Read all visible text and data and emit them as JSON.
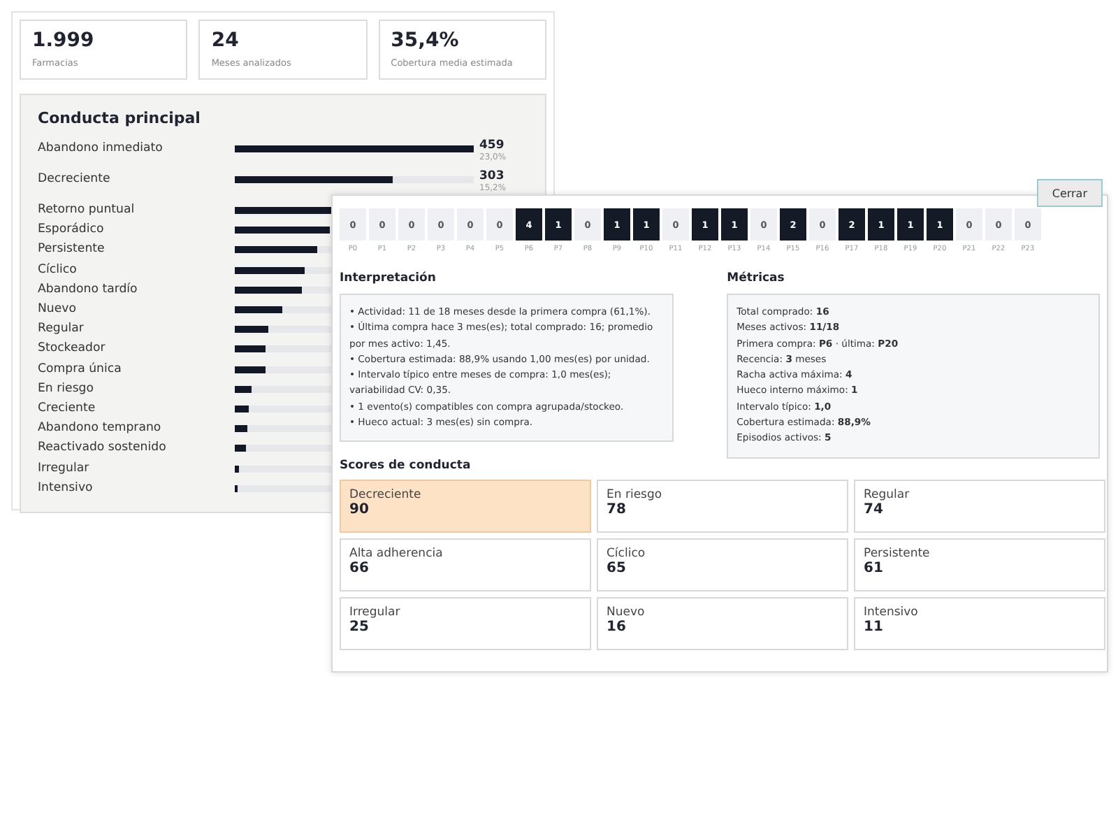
{
  "stats": [
    {
      "value": "1.999",
      "label": "Farmacias"
    },
    {
      "value": "24",
      "label": "Meses analizados"
    },
    {
      "value": "35,4%",
      "label": "Cobertura media estimada"
    }
  ],
  "conducta": {
    "title": "Conducta principal",
    "rows": [
      {
        "label": "Abandono inmediato",
        "level": 1.0,
        "count": "459",
        "pct": "23,0%"
      },
      {
        "label": "Decreciente",
        "level": 0.66,
        "count": "303",
        "pct": "15,2%"
      },
      {
        "label": "Retorno puntual",
        "level": 0.47
      },
      {
        "label": "Esporádico",
        "level": 0.4
      },
      {
        "label": "Persistente",
        "level": 0.345
      },
      {
        "label": "Cíclico",
        "level": 0.29
      },
      {
        "label": "Abandono tardío",
        "level": 0.28
      },
      {
        "label": "Nuevo",
        "level": 0.2
      },
      {
        "label": "Regular",
        "level": 0.14
      },
      {
        "label": "Stockeador",
        "level": 0.13
      },
      {
        "label": "Compra única",
        "level": 0.13
      },
      {
        "label": "En riesgo",
        "level": 0.07
      },
      {
        "label": "Creciente",
        "level": 0.06
      },
      {
        "label": "Abandono temprano",
        "level": 0.05
      },
      {
        "label": "Reactivado sostenido",
        "level": 0.045
      },
      {
        "label": "Irregular",
        "level": 0.02
      },
      {
        "label": "Intensivo",
        "level": 0.012
      }
    ]
  },
  "modal": {
    "close_button": "Cerrar",
    "months": [
      {
        "value": "0",
        "label": "P0",
        "active": false
      },
      {
        "value": "0",
        "label": "P1",
        "active": false
      },
      {
        "value": "0",
        "label": "P2",
        "active": false
      },
      {
        "value": "0",
        "label": "P3",
        "active": false
      },
      {
        "value": "0",
        "label": "P4",
        "active": false
      },
      {
        "value": "0",
        "label": "P5",
        "active": false
      },
      {
        "value": "4",
        "label": "P6",
        "active": true
      },
      {
        "value": "1",
        "label": "P7",
        "active": true
      },
      {
        "value": "0",
        "label": "P8",
        "active": false
      },
      {
        "value": "1",
        "label": "P9",
        "active": true
      },
      {
        "value": "1",
        "label": "P10",
        "active": true
      },
      {
        "value": "0",
        "label": "P11",
        "active": false
      },
      {
        "value": "1",
        "label": "P12",
        "active": true
      },
      {
        "value": "1",
        "label": "P13",
        "active": true
      },
      {
        "value": "0",
        "label": "P14",
        "active": false
      },
      {
        "value": "2",
        "label": "P15",
        "active": true
      },
      {
        "value": "0",
        "label": "P16",
        "active": false
      },
      {
        "value": "2",
        "label": "P17",
        "active": true
      },
      {
        "value": "1",
        "label": "P18",
        "active": true
      },
      {
        "value": "1",
        "label": "P19",
        "active": true
      },
      {
        "value": "1",
        "label": "P20",
        "active": true
      },
      {
        "value": "0",
        "label": "P21",
        "active": false
      },
      {
        "value": "0",
        "label": "P22",
        "active": false
      },
      {
        "value": "0",
        "label": "P23",
        "active": false
      }
    ],
    "interpretation": {
      "title": "Interpretación",
      "items": [
        "• Actividad: 11 de 18 meses desde la primera compra (61,1%).",
        "• Última compra hace 3 mes(es); total comprado: 16; promedio por mes activo: 1,45.",
        "• Cobertura estimada: 88,9% usando 1,00 mes(es) por unidad.",
        "• Intervalo típico entre meses de compra: 1,0 mes(es); variabilidad CV: 0,35.",
        "• 1 evento(s) compatibles con compra agrupada/stockeo.",
        "• Hueco actual: 3 mes(es) sin compra."
      ]
    },
    "metrics": {
      "title": "Métricas",
      "items": [
        "Total comprado: **16**",
        "Meses activos: **11/18**",
        "Primera compra: **P6** · última: **P20**",
        "Recencia: **3** meses",
        "Racha activa máxima: **4**",
        "Hueco interno máximo: **1**",
        "Intervalo típico: **1,0**",
        "Cobertura estimada: **88,9%**",
        "Episodios activos: **5**"
      ]
    },
    "scores": {
      "title": "Scores de conducta",
      "items": [
        {
          "label": "Decreciente",
          "value": "90",
          "selected": true
        },
        {
          "label": "En riesgo",
          "value": "78",
          "selected": false
        },
        {
          "label": "Regular",
          "value": "74",
          "selected": false
        },
        {
          "label": "Alta adherencia",
          "value": "66",
          "selected": false
        },
        {
          "label": "Cíclico",
          "value": "65",
          "selected": false
        },
        {
          "label": "Persistente",
          "value": "61",
          "selected": false
        },
        {
          "label": "Irregular",
          "value": "25",
          "selected": false
        },
        {
          "label": "Nuevo",
          "value": "16",
          "selected": false
        },
        {
          "label": "Intensivo",
          "value": "11",
          "selected": false
        }
      ]
    }
  }
}
